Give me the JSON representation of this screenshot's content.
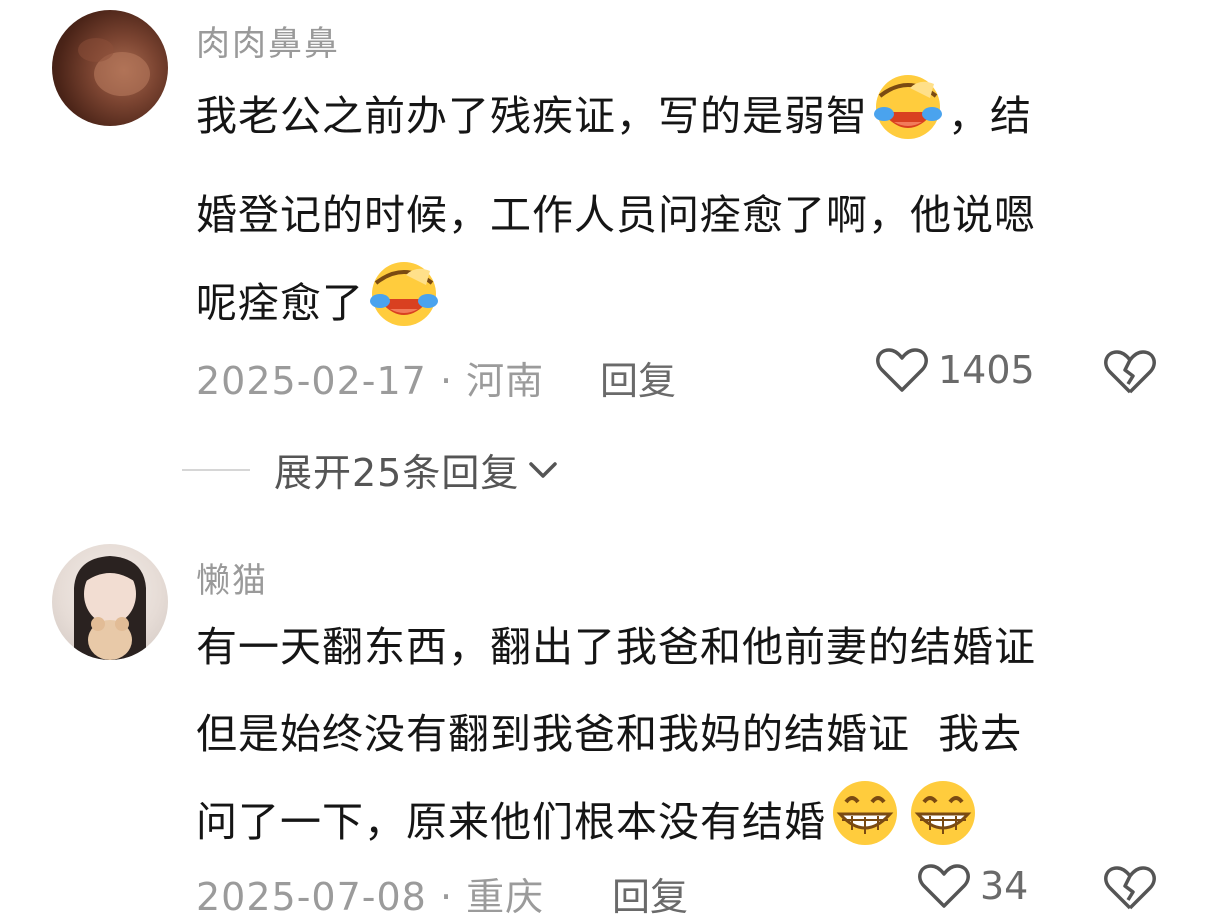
{
  "comments": [
    {
      "username": "肉肉鼻鼻",
      "lines": [
        "我老公之前办了残疾证，写的是弱智",
        "，结",
        "婚登记的时候，工作人员问痊愈了啊，他说嗯",
        "呢痊愈了"
      ],
      "emojis": [
        "laughing-crying",
        "laughing-crying"
      ],
      "date": "2025-02-17",
      "location": "河南",
      "reply_label": "回复",
      "likes": "1405",
      "expand_label": "展开25条回复"
    },
    {
      "username": "懒猫",
      "lines": [
        "有一天翻东西，翻出了我爸和他前妻的结婚证",
        "但是始终没有翻到我爸和我妈的结婚证  我去",
        "问了一下，原来他们根本没有结婚"
      ],
      "emojis": [
        "grinning",
        "grinning"
      ],
      "date": "2025-07-08",
      "location": "重庆",
      "reply_label": "回复",
      "likes": "34"
    }
  ]
}
